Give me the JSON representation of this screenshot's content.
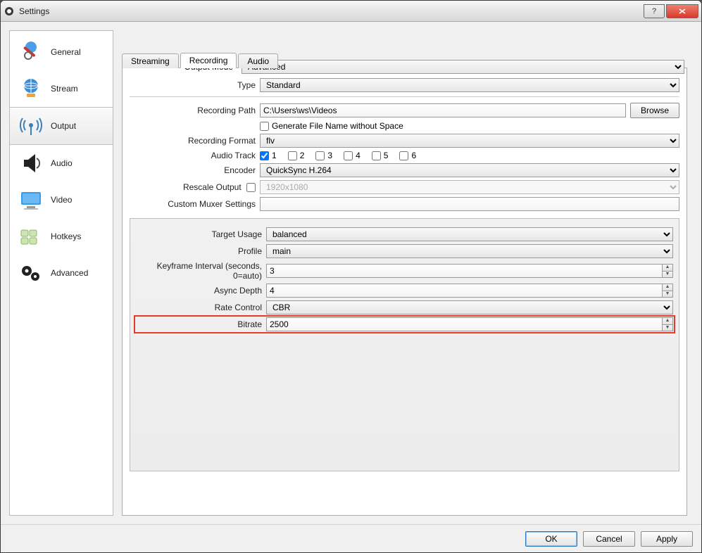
{
  "window": {
    "title": "Settings"
  },
  "sidebar": {
    "items": [
      {
        "label": "General"
      },
      {
        "label": "Stream"
      },
      {
        "label": "Output"
      },
      {
        "label": "Audio"
      },
      {
        "label": "Video"
      },
      {
        "label": "Hotkeys"
      },
      {
        "label": "Advanced"
      }
    ]
  },
  "outputMode": {
    "label": "Output Mode",
    "value": "Advanced"
  },
  "tabs": [
    {
      "label": "Streaming"
    },
    {
      "label": "Recording"
    },
    {
      "label": "Audio"
    }
  ],
  "recording": {
    "type": {
      "label": "Type",
      "value": "Standard"
    },
    "path": {
      "label": "Recording Path",
      "value": "C:\\Users\\ws\\Videos",
      "browse": "Browse"
    },
    "nospace": {
      "label": "Generate File Name without Space"
    },
    "format": {
      "label": "Recording Format",
      "value": "flv"
    },
    "audioTrack": {
      "label": "Audio Track",
      "tracks": [
        "1",
        "2",
        "3",
        "4",
        "5",
        "6"
      ]
    },
    "encoder": {
      "label": "Encoder",
      "value": "QuickSync H.264"
    },
    "rescale": {
      "label": "Rescale Output",
      "value": "1920x1080"
    },
    "muxer": {
      "label": "Custom Muxer Settings",
      "value": ""
    }
  },
  "encoderSettings": {
    "targetUsage": {
      "label": "Target Usage",
      "value": "balanced"
    },
    "profile": {
      "label": "Profile",
      "value": "main"
    },
    "keyframe": {
      "label": "Keyframe Interval (seconds, 0=auto)",
      "value": "3"
    },
    "asyncDepth": {
      "label": "Async Depth",
      "value": "4"
    },
    "rateControl": {
      "label": "Rate Control",
      "value": "CBR"
    },
    "bitrate": {
      "label": "Bitrate",
      "value": "2500"
    }
  },
  "footer": {
    "ok": "OK",
    "cancel": "Cancel",
    "apply": "Apply"
  }
}
